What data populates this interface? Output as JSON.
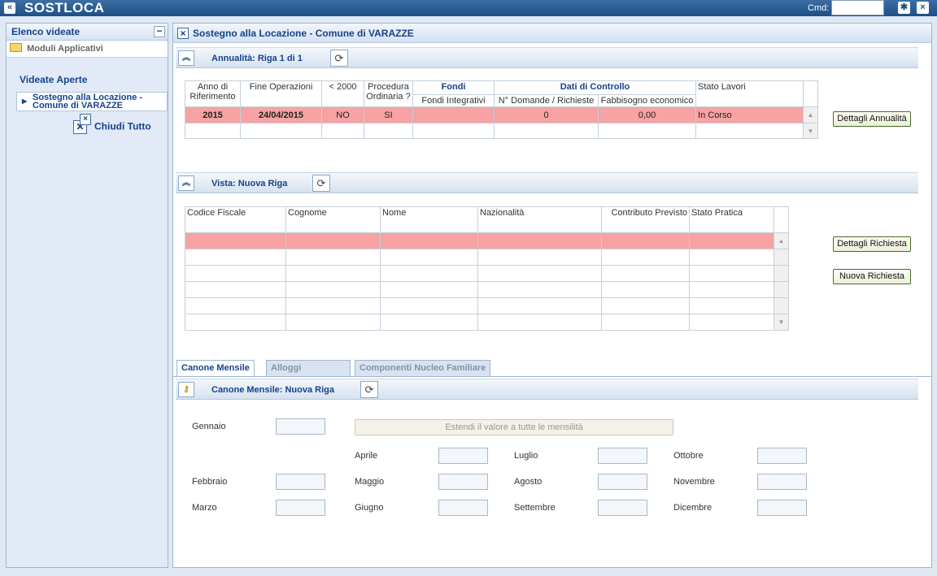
{
  "app": {
    "title": "SOSTLOCA",
    "cmd_label": "Cmd:",
    "cmd_value": ""
  },
  "sidebar": {
    "header": "Elenco videate",
    "modules": "Moduli Applicativi",
    "open_title": "Videate Aperte",
    "open_item_line1": "Sostegno alla Locazione -",
    "open_item_line2": "Comune di VARAZZE",
    "close_all": "Chiudi Tutto"
  },
  "main": {
    "title": "Sostegno alla Locazione - Comune di VARAZZE"
  },
  "annualita": {
    "title": "Annualità: Riga 1 di 1",
    "headers": {
      "anno": "Anno di Riferimento",
      "fine": "Fine Operazioni",
      "lt2000": "< 2000",
      "procedura": "Procedura Ordinaria ?",
      "fondi_group": "Fondi",
      "controllo_group": "Dati di Controllo",
      "stato": "Stato Lavori",
      "fondi_integrativi": "Fondi Integrativi",
      "n_domande": "N° Domande / Richieste",
      "fabbisogno": "Fabbisogno economico"
    },
    "row": {
      "anno": "2015",
      "fine": "24/04/2015",
      "lt2000": "NO",
      "procedura": "SI",
      "fondi": "",
      "n_domande": "0",
      "fabbisogno": "0,00",
      "stato": "In Corso"
    },
    "button": "Dettagli Annualità"
  },
  "vista": {
    "title": "Vista: Nuova Riga",
    "headers": [
      "Codice Fiscale",
      "Cognome",
      "Nome",
      "Nazionalità",
      "Contributo Previsto",
      "Stato Pratica"
    ],
    "buttons": {
      "dettagli": "Dettagli Richiesta",
      "nuova": "Nuova Richiesta"
    }
  },
  "tabs": [
    "Canone Mensile",
    "Alloggi",
    "Componenti Nucleo Familiare"
  ],
  "canone": {
    "title": "Canone Mensile: Nuova Riga",
    "extend_button": "Estendi il valore a tutte le mensilità",
    "months": {
      "gennaio": "Gennaio",
      "febbraio": "Febbraio",
      "marzo": "Marzo",
      "aprile": "Aprile",
      "maggio": "Maggio",
      "giugno": "Giugno",
      "luglio": "Luglio",
      "agosto": "Agosto",
      "settembre": "Settembre",
      "ottobre": "Ottobre",
      "novembre": "Novembre",
      "dicembre": "Dicembre"
    }
  },
  "icons": {
    "back": "double-left-arrow-icon",
    "bug": "bug-icon",
    "close": "close-icon",
    "collapse": "double-up-arrow-icon",
    "refresh": "refresh-icon",
    "key": "key-icon"
  },
  "colors": {
    "selected_row": "#f7a2a3",
    "header_text": "#15428b"
  }
}
